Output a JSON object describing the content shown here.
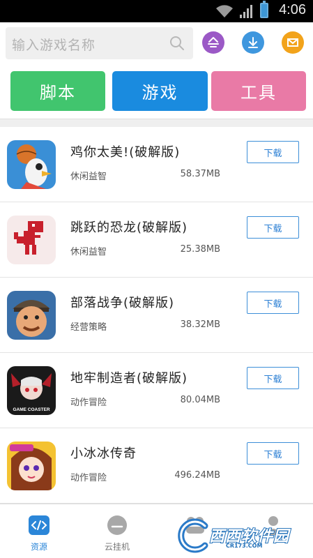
{
  "status_bar": {
    "time": "4:06"
  },
  "search": {
    "placeholder": "输入游戏名称"
  },
  "header_actions": [
    {
      "icon": "filter-icon",
      "color": "#9b59c6"
    },
    {
      "icon": "download-icon",
      "color": "#3f97de"
    },
    {
      "icon": "mail-icon",
      "color": "#f2a31b"
    }
  ],
  "categories": [
    {
      "label": "脚本",
      "color": "#41c56e"
    },
    {
      "label": "游戏",
      "color": "#1a8bdf"
    },
    {
      "label": "工具",
      "color": "#e97aa6"
    }
  ],
  "apps": [
    {
      "name": "鸡你太美!(破解版)",
      "category": "休闲益智",
      "size": "58.37MB",
      "action": "下载"
    },
    {
      "name": "跳跃的恐龙(破解版)",
      "category": "休闲益智",
      "size": "25.38MB",
      "action": "下载"
    },
    {
      "name": "部落战争(破解版)",
      "category": "经营策略",
      "size": "38.32MB",
      "action": "下载"
    },
    {
      "name": "地牢制造者(破解版)",
      "category": "动作冒险",
      "size": "80.04MB",
      "action": "下载",
      "icon_caption": "GAME COASTER"
    },
    {
      "name": "小冰冰传奇",
      "category": "动作冒险",
      "size": "496.24MB",
      "action": "下载"
    }
  ],
  "tabs": [
    {
      "label": "资源",
      "active": true
    },
    {
      "label": "云挂机",
      "active": false
    },
    {
      "label": "",
      "active": false
    },
    {
      "label": "",
      "active": false
    }
  ],
  "watermark": {
    "text": "西西软件园",
    "sub": "CR173.COM"
  },
  "colors": {
    "accent": "#2b86d8",
    "statusbar": "#000000"
  }
}
